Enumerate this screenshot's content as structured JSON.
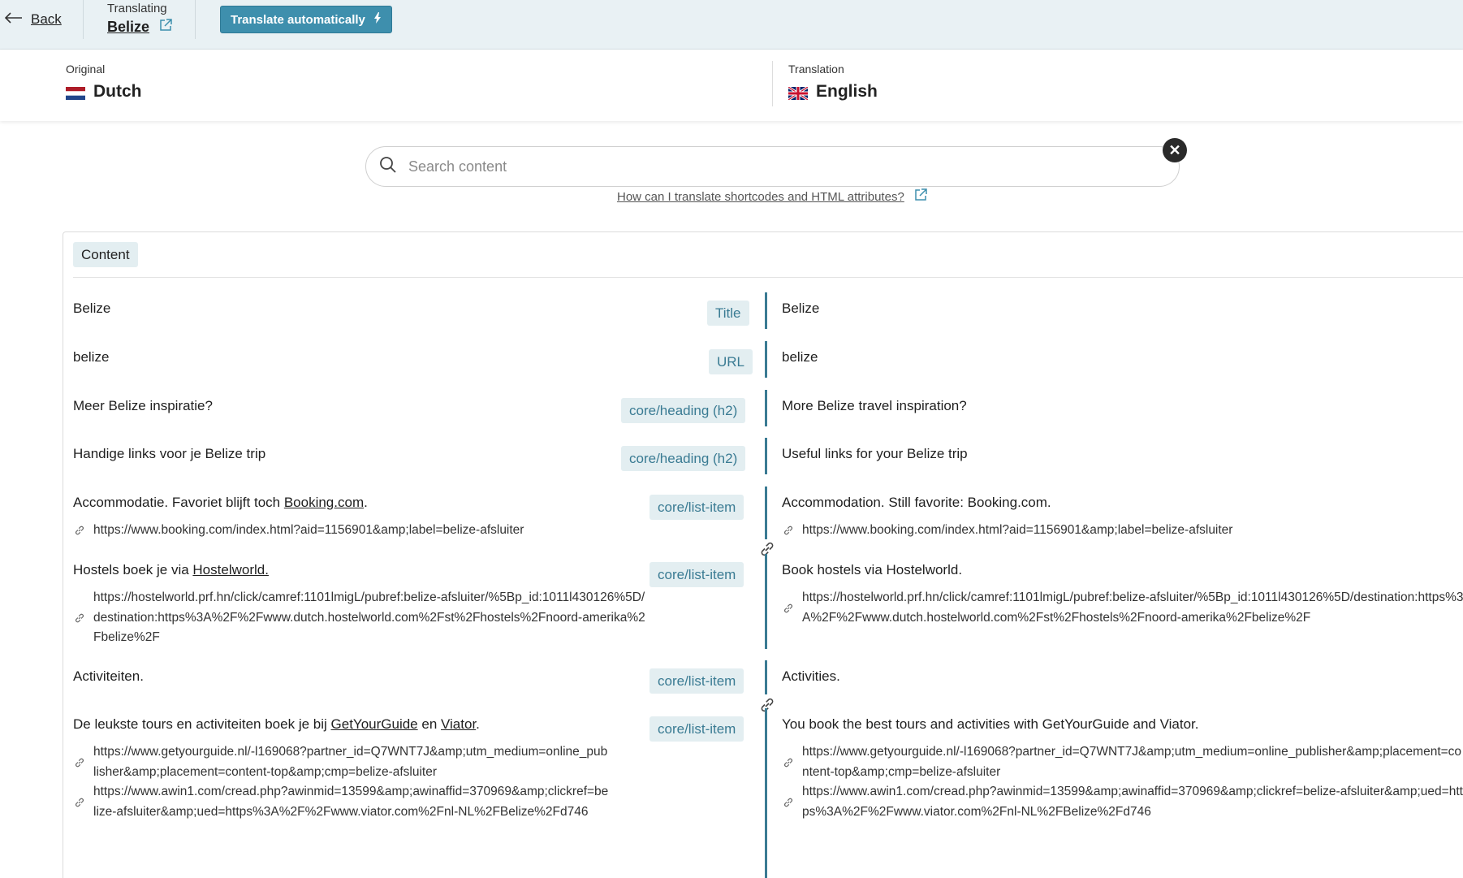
{
  "topbar": {
    "back_label": "Back",
    "translating_label": "Translating",
    "item_name": "Belize",
    "auto_button_label": "Translate automatically"
  },
  "languages": {
    "original_label": "Original",
    "original_name": "Dutch",
    "translation_label": "Translation",
    "translation_name": "English"
  },
  "search": {
    "placeholder": "Search content",
    "help_link": "How can I translate shortcodes and HTML attributes?"
  },
  "section": {
    "label": "Content"
  },
  "rows": [
    {
      "source": "Belize",
      "tag": "Title",
      "target": "Belize"
    },
    {
      "source": "belize",
      "tag": "URL",
      "target": "belize"
    },
    {
      "source": "Meer Belize inspiratie?",
      "tag": "core/heading (h2)",
      "target": "More Belize travel inspiration?"
    },
    {
      "source": "Handige links voor je Belize trip",
      "tag": "core/heading (h2)",
      "target": "Useful links for your Belize trip"
    },
    {
      "source_text": "Accommodatie. Favoriet blijft toch ",
      "source_link": "Booking.com",
      "source_end": ".",
      "tag": "core/list-item",
      "target": "Accommodation. Still favorite: Booking.com.",
      "source_url": "https://www.booking.com/index.html?aid=1156901&amp;label=belize-afsluiter",
      "target_url": "https://www.booking.com/index.html?aid=1156901&amp;label=belize-afsluiter"
    },
    {
      "source_text": "Hostels boek je via ",
      "source_link": "Hostelworld.",
      "tag": "core/list-item",
      "target": "Book hostels via Hostelworld.",
      "source_url": "https://hostelworld.prf.hn/click/camref:1101lmigL/pubref:belize-afsluiter/%5Bp_id:1011l430126%5D/destination:https%3A%2F%2Fwww.dutch.hostelworld.com%2Fst%2Fhostels%2Fnoord-amerika%2Fbelize%2F",
      "target_url": "https://hostelworld.prf.hn/click/camref:1101lmigL/pubref:belize-afsluiter/%5Bp_id:1011l430126%5D/destination:https%3A%2F%2Fwww.dutch.hostelworld.com%2Fst%2Fhostels%2Fnoord-amerika%2Fbelize%2F"
    },
    {
      "source": "Activiteiten.",
      "tag": "core/list-item",
      "target": "Activities."
    },
    {
      "source_text": "De leukste tours en activiteiten boek je bij ",
      "source_link": "GetYourGuide",
      "source_mid": " en ",
      "source_link2": "Viator",
      "source_end": ".",
      "tag": "core/list-item",
      "target": "You book the best tours and activities with GetYourGuide and Viator.",
      "source_url": "https://www.getyourguide.nl/-l169068?partner_id=Q7WNT7J&amp;utm_medium=online_publisher&amp;placement=content-top&amp;cmp=belize-afsluiter",
      "source_url2": "https://www.awin1.com/cread.php?awinmid=13599&amp;awinaffid=370969&amp;clickref=belize-afsluiter&amp;ued=https%3A%2F%2Fwww.viator.com%2Fnl-NL%2FBelize%2Fd746",
      "target_url": "https://www.getyourguide.nl/-l169068?partner_id=Q7WNT7J&amp;utm_medium=online_publisher&amp;placement=content-top&amp;cmp=belize-afsluiter",
      "target_url2": "https://www.awin1.com/cread.php?awinmid=13599&amp;awinaffid=370969&amp;clickref=belize-afsluiter&amp;ued=https%3A%2F%2Fwww.viator.com%2Fnl-NL%2FBelize%2Fd746"
    }
  ],
  "colors": {
    "accent": "#3e8fad",
    "tag_bg": "#e3eef1",
    "tag_text": "#3a7b93",
    "topbar_bg": "#e9f1f4"
  },
  "icons": {
    "back": "arrow-left-icon",
    "external": "external-link-icon",
    "bolt": "lightning-icon",
    "search": "search-icon",
    "clear": "close-icon",
    "link": "link-icon"
  }
}
